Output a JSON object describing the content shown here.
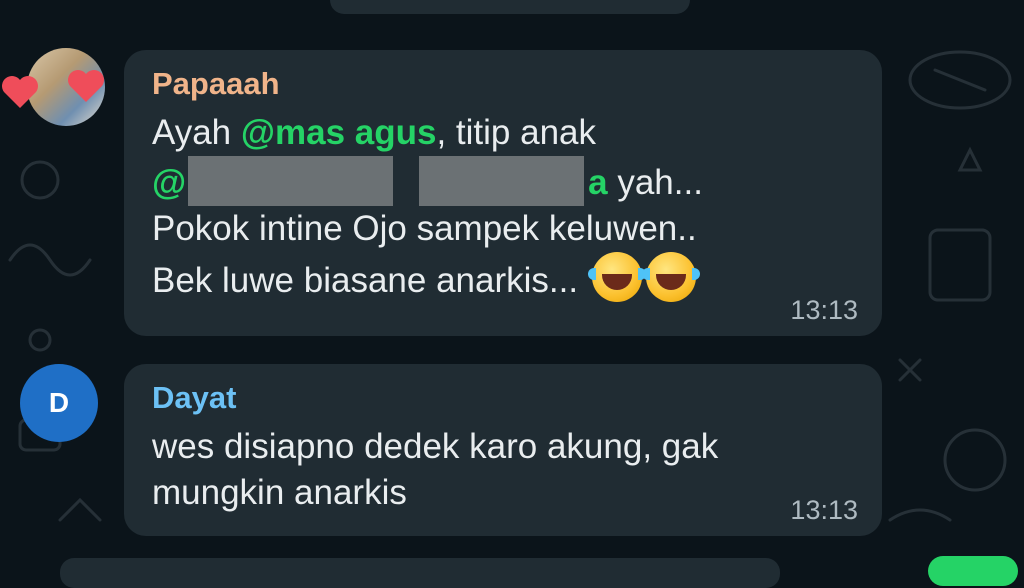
{
  "messages": [
    {
      "sender": "Papaaah",
      "text_1": "Ayah ",
      "mention_1": "@mas agus",
      "text_2": ", titip anak",
      "mention_2_start": "@",
      "mention_2_end": "a",
      "text_3": " yah...",
      "line_3": "Pokok intine Ojo sampek keluwen..",
      "line_4": "Bek luwe biasane anarkis...",
      "emojis": [
        "face-with-tears-of-joy",
        "face-with-tears-of-joy"
      ],
      "time": "13:13",
      "avatar": "profile-photo"
    },
    {
      "sender": "Dayat",
      "avatar_letter": "D",
      "line_1": "wes disiapno dedek karo akung, gak",
      "line_2": "mungkin anarkis",
      "time": "13:13"
    }
  ],
  "colors": {
    "background": "#0b141a",
    "bubble": "#202c33",
    "mention": "#25d366",
    "sender_1": "#f0b48a",
    "sender_2": "#6cc1f5",
    "avatar_d": "#1f6fc6"
  }
}
